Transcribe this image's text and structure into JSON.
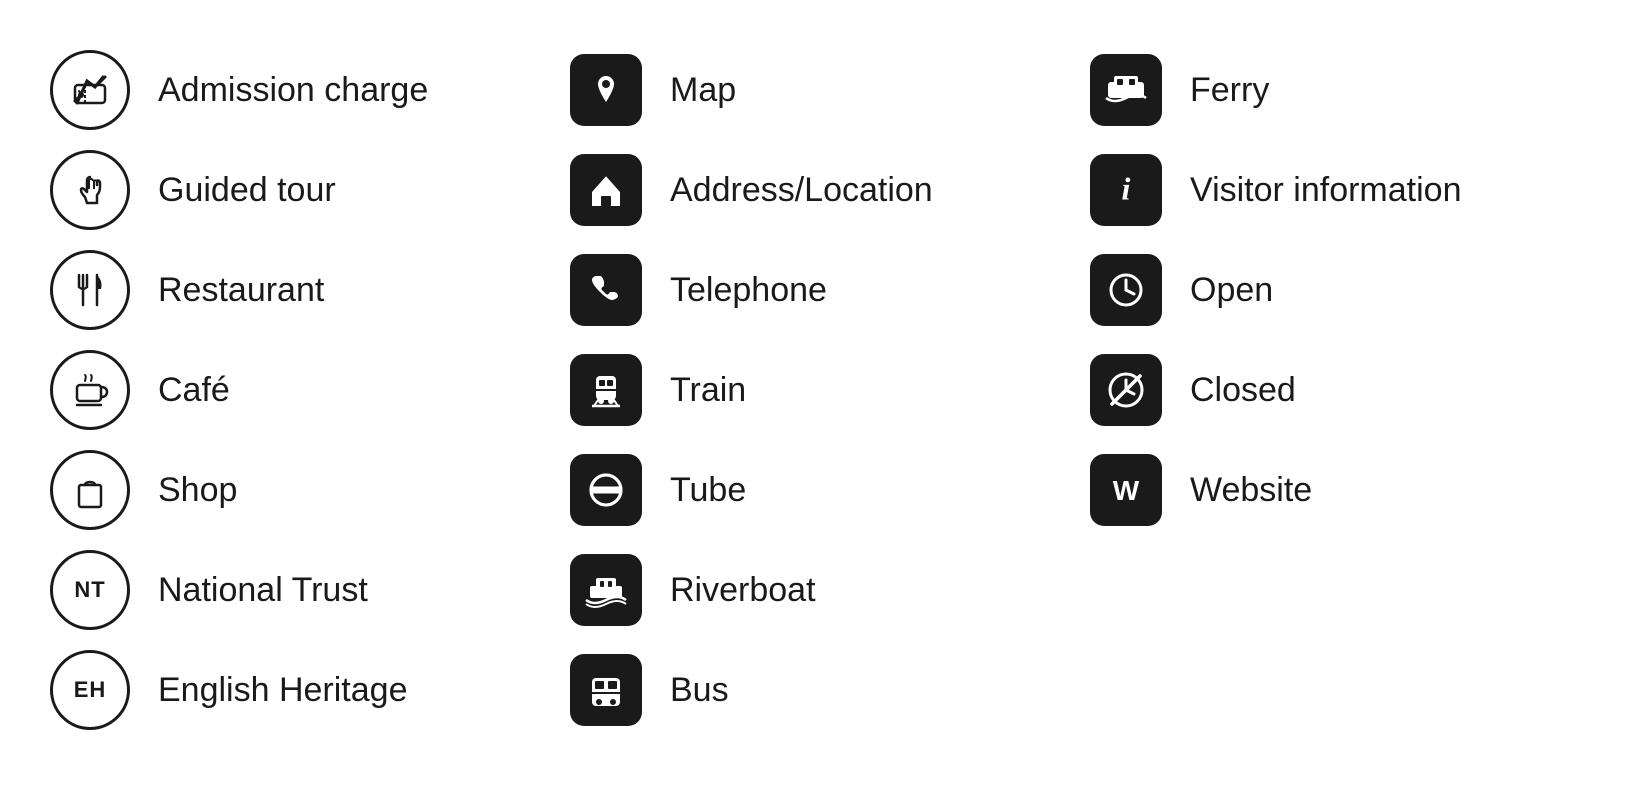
{
  "items": {
    "col1": [
      {
        "id": "admission-charge",
        "label": "Admission charge",
        "icon_type": "circle",
        "icon_id": "ticket-icon"
      },
      {
        "id": "guided-tour",
        "label": "Guided tour",
        "icon_type": "circle",
        "icon_id": "guided-tour-icon"
      },
      {
        "id": "restaurant",
        "label": "Restaurant",
        "icon_type": "circle",
        "icon_id": "restaurant-icon"
      },
      {
        "id": "cafe",
        "label": "Café",
        "icon_type": "circle",
        "icon_id": "cafe-icon"
      },
      {
        "id": "shop",
        "label": "Shop",
        "icon_type": "circle",
        "icon_id": "shop-icon"
      },
      {
        "id": "national-trust",
        "label": "National Trust",
        "icon_type": "circle",
        "icon_id": "nt-icon"
      },
      {
        "id": "english-heritage",
        "label": "English Heritage",
        "icon_type": "circle",
        "icon_id": "eh-icon"
      }
    ],
    "col2": [
      {
        "id": "map",
        "label": "Map",
        "icon_type": "square",
        "icon_id": "map-icon"
      },
      {
        "id": "address",
        "label": "Address/Location",
        "icon_type": "square",
        "icon_id": "address-icon"
      },
      {
        "id": "telephone",
        "label": "Telephone",
        "icon_type": "square",
        "icon_id": "telephone-icon"
      },
      {
        "id": "train",
        "label": "Train",
        "icon_type": "square",
        "icon_id": "train-icon"
      },
      {
        "id": "tube",
        "label": "Tube",
        "icon_type": "square",
        "icon_id": "tube-icon"
      },
      {
        "id": "riverboat",
        "label": "Riverboat",
        "icon_type": "square",
        "icon_id": "riverboat-icon"
      },
      {
        "id": "bus",
        "label": "Bus",
        "icon_type": "square",
        "icon_id": "bus-icon"
      }
    ],
    "col3": [
      {
        "id": "ferry",
        "label": "Ferry",
        "icon_type": "square",
        "icon_id": "ferry-icon"
      },
      {
        "id": "visitor-info",
        "label": "Visitor information",
        "icon_type": "square",
        "icon_id": "visitor-info-icon"
      },
      {
        "id": "open",
        "label": "Open",
        "icon_type": "square",
        "icon_id": "open-icon"
      },
      {
        "id": "closed",
        "label": "Closed",
        "icon_type": "special",
        "icon_id": "closed-icon"
      },
      {
        "id": "website",
        "label": "Website",
        "icon_type": "square",
        "icon_id": "website-icon"
      }
    ]
  }
}
